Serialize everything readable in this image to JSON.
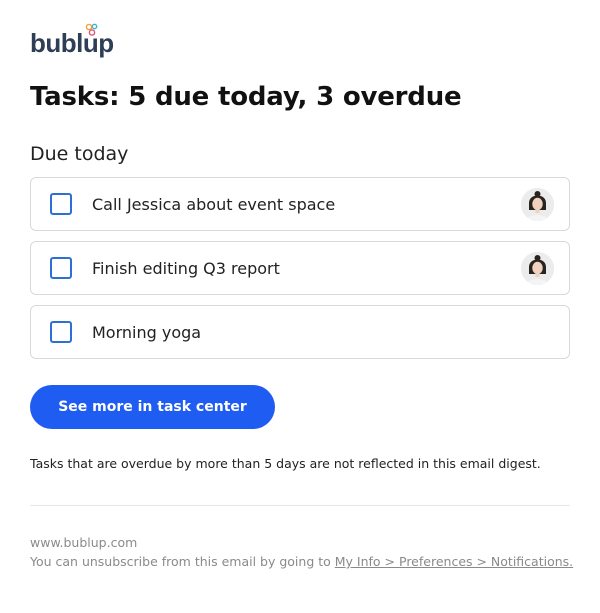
{
  "brand": {
    "logo_text": "bublup",
    "colors": {
      "logo": "#2f3e57",
      "accent": "#1f5cf2",
      "checkbox": "#2d6fd4"
    }
  },
  "header": {
    "title": "Tasks: 5 due today, 3 overdue"
  },
  "due_today": {
    "label": "Due today",
    "tasks": [
      {
        "text": "Call Jessica about event space",
        "avatar": "assignee-avatar"
      },
      {
        "text": "Finish editing Q3 report",
        "avatar": "assignee-avatar"
      },
      {
        "text": "Morning yoga"
      }
    ]
  },
  "cta": {
    "label": "See more in task center"
  },
  "note": "Tasks that are overdue by more than 5 days are not reflected in this email digest.",
  "footer": {
    "site": "www.bublup.com",
    "unsubscribe_prefix": "You can unsubscribe from this email by going to ",
    "unsubscribe_link": "My Info > Preferences > Notifications."
  }
}
